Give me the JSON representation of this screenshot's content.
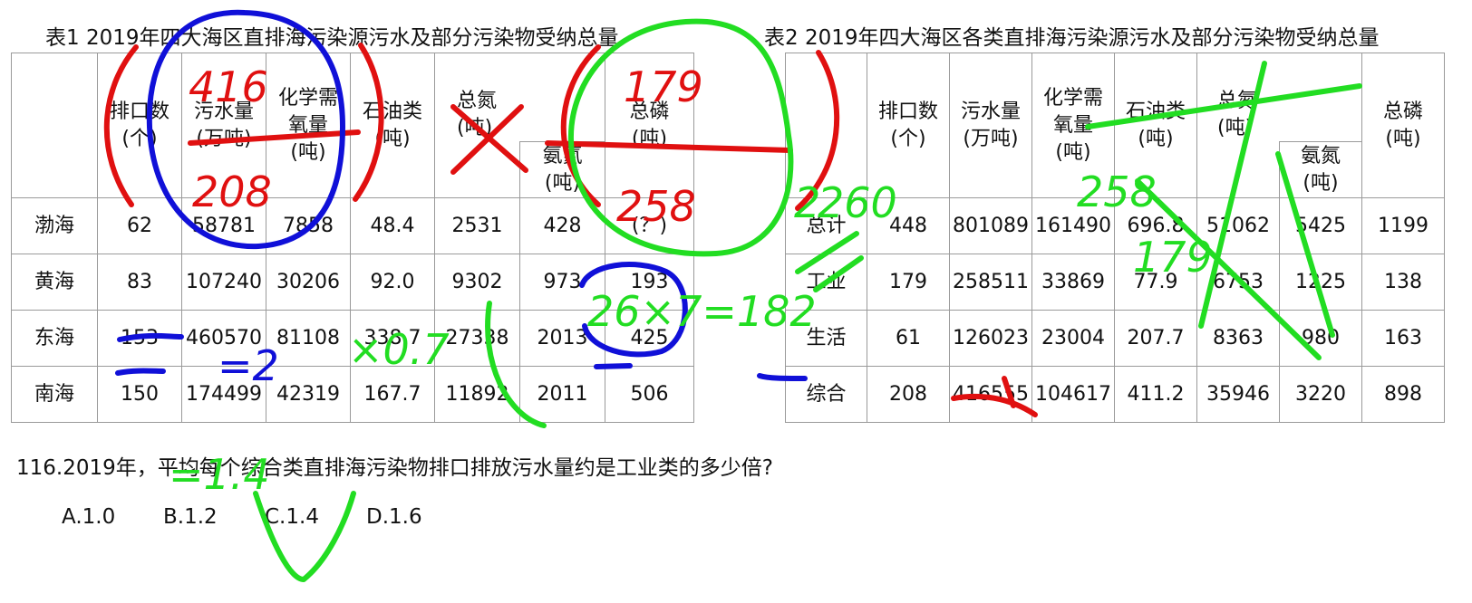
{
  "table1": {
    "title": "表1  2019年四大海区直排海污染源污水及部分污染物受纳总量",
    "headers": {
      "outlets": [
        "排口数",
        "(个)"
      ],
      "sewage": [
        "污水量",
        "(万吨)"
      ],
      "cod": [
        "化学需",
        "氧量",
        "(吨)"
      ],
      "oil": [
        "石油类",
        "(吨)"
      ],
      "nitrogen": [
        "总氮",
        "(吨)"
      ],
      "ammonia": [
        "氨氮",
        "(吨)"
      ],
      "phosphorus": [
        "总磷",
        "(吨)"
      ]
    },
    "rows": [
      {
        "name": "渤海",
        "cells": [
          "62",
          "58781",
          "7858",
          "48.4",
          "2531",
          "428",
          "(？)"
        ]
      },
      {
        "name": "黄海",
        "cells": [
          "83",
          "107240",
          "30206",
          "92.0",
          "9302",
          "973",
          "193"
        ]
      },
      {
        "name": "东海",
        "cells": [
          "153",
          "460570",
          "81108",
          "338.7",
          "27338",
          "2013",
          "425"
        ]
      },
      {
        "name": "南海",
        "cells": [
          "150",
          "174499",
          "42319",
          "167.7",
          "11892",
          "2011",
          "506"
        ]
      }
    ]
  },
  "table2": {
    "title": "表2  2019年四大海区各类直排海污染源污水及部分污染物受纳总量",
    "headers": {
      "outlets": [
        "排口数",
        "(个)"
      ],
      "sewage": [
        "污水量",
        "(万吨)"
      ],
      "cod": [
        "化学需",
        "氧量",
        "(吨)"
      ],
      "oil": [
        "石油类",
        "(吨)"
      ],
      "nitrogen": [
        "总氮",
        "(吨)"
      ],
      "ammonia": [
        "氨氮",
        "(吨)"
      ],
      "phosphorus": [
        "总磷",
        "(吨)"
      ]
    },
    "rows": [
      {
        "name": "总计",
        "cells": [
          "448",
          "801089",
          "161490",
          "696.8",
          "51062",
          "5425",
          "1199"
        ]
      },
      {
        "name": "工业",
        "cells": [
          "179",
          "258511",
          "33869",
          "77.9",
          "6753",
          "1225",
          "138"
        ]
      },
      {
        "name": "生活",
        "cells": [
          "61",
          "126023",
          "23004",
          "207.7",
          "8363",
          "980",
          "163"
        ]
      },
      {
        "name": "综合",
        "cells": [
          "208",
          "416555",
          "104617",
          "411.2",
          "35946",
          "3220",
          "898"
        ]
      }
    ]
  },
  "question": "116.2019年，平均每个综合类直排海污染物排口排放污水量约是工业类的多少倍?",
  "options": [
    "A.1.0",
    "B.1.2",
    "C.1.4",
    "D.1.6"
  ],
  "annotations": {
    "t1_sewage_num": "416",
    "t1_sewage_den": "208",
    "t1_p_num": "179",
    "t1_p_den": "258",
    "t2_total": "260",
    "t2_top": "258",
    "t2_factor": "2",
    "t2_side": "179",
    "t2_product": "26×7=182",
    "result_lhs": "=2",
    "result_factor": "×0.7",
    "result": "=1.4",
    "colors": {
      "red": "#e01010",
      "blue": "#1010d8",
      "green": "#22dd22"
    }
  }
}
